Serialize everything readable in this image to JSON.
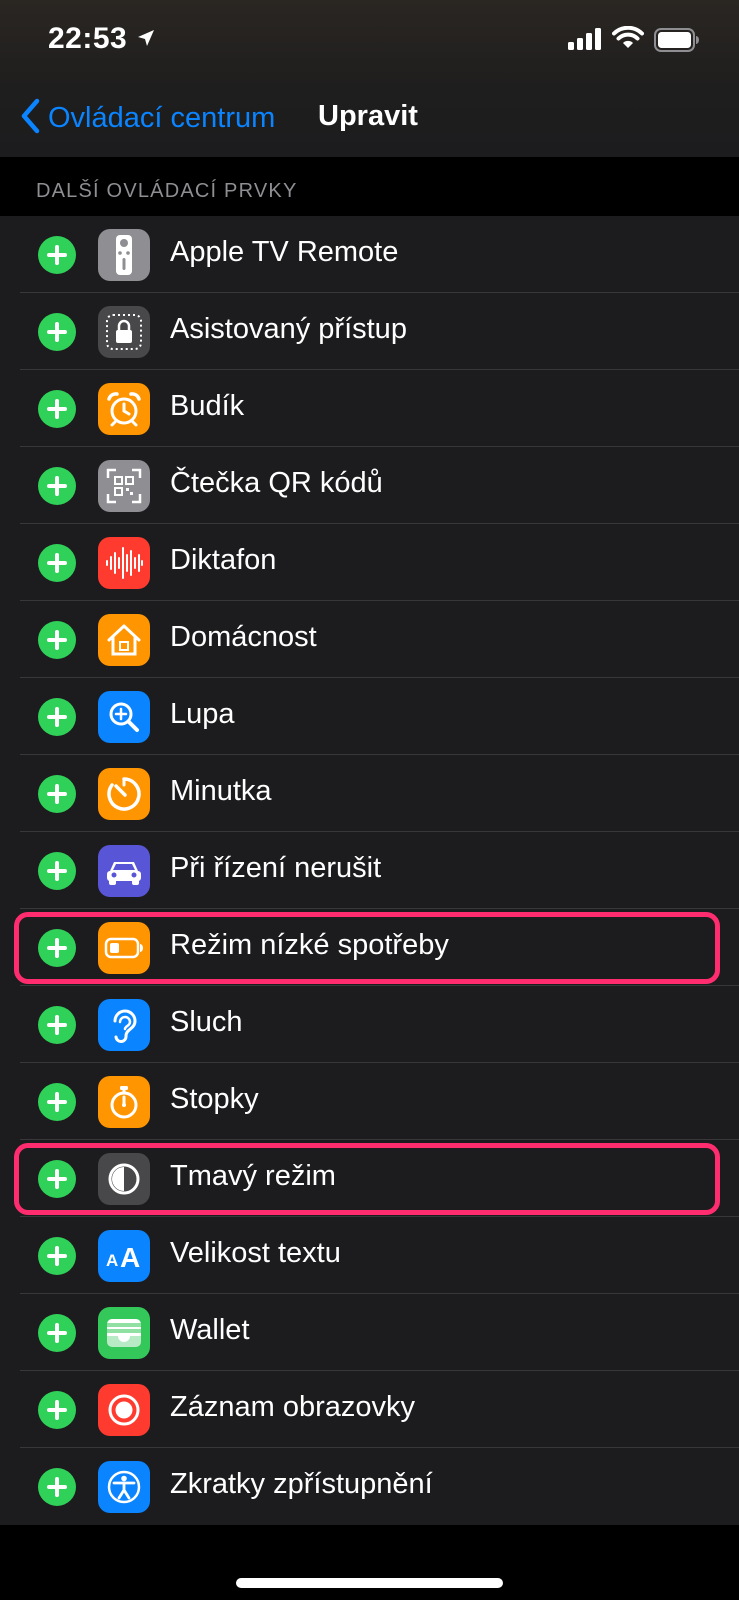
{
  "status_bar": {
    "time": "22:53"
  },
  "nav": {
    "back_label": "Ovládací centrum",
    "title": "Upravit"
  },
  "section": {
    "header": "DALŠÍ OVLÁDACÍ PRVKY"
  },
  "colors": {
    "accent": "#0a84ff",
    "add": "#30d158",
    "highlight": "#ff2d6f",
    "row_bg": "#1c1c1e"
  },
  "controls": [
    {
      "label": "Apple TV Remote",
      "icon": "apple-tv-remote-icon",
      "color": "#8e8e93",
      "highlighted": false
    },
    {
      "label": "Asistovaný přístup",
      "icon": "guided-access-icon",
      "color": "#48484a",
      "highlighted": false
    },
    {
      "label": "Budík",
      "icon": "alarm-clock-icon",
      "color": "#ff9500",
      "highlighted": false
    },
    {
      "label": "Čtečka QR kódů",
      "icon": "qr-code-icon",
      "color": "#8e8e93",
      "highlighted": false
    },
    {
      "label": "Diktafon",
      "icon": "voice-memo-icon",
      "color": "#ff3b30",
      "highlighted": false
    },
    {
      "label": "Domácnost",
      "icon": "home-icon",
      "color": "#ff9500",
      "highlighted": false
    },
    {
      "label": "Lupa",
      "icon": "magnifier-icon",
      "color": "#0a84ff",
      "highlighted": false
    },
    {
      "label": "Minutka",
      "icon": "timer-icon",
      "color": "#ff9500",
      "highlighted": false
    },
    {
      "label": "Při řízení nerušit",
      "icon": "car-icon",
      "color": "#5856d6",
      "highlighted": false
    },
    {
      "label": "Režim nízké spotřeby",
      "icon": "battery-low-icon",
      "color": "#ff9500",
      "highlighted": true
    },
    {
      "label": "Sluch",
      "icon": "ear-icon",
      "color": "#0a84ff",
      "highlighted": false
    },
    {
      "label": "Stopky",
      "icon": "stopwatch-icon",
      "color": "#ff9500",
      "highlighted": false
    },
    {
      "label": "Tmavý režim",
      "icon": "dark-mode-icon",
      "color": "#48484a",
      "highlighted": true
    },
    {
      "label": "Velikost textu",
      "icon": "text-size-icon",
      "color": "#0a84ff",
      "highlighted": false
    },
    {
      "label": "Wallet",
      "icon": "wallet-icon",
      "color": "#34c759",
      "highlighted": false
    },
    {
      "label": "Záznam obrazovky",
      "icon": "screen-record-icon",
      "color": "#ff3b30",
      "highlighted": false
    },
    {
      "label": "Zkratky zpřístupnění",
      "icon": "accessibility-icon",
      "color": "#0a84ff",
      "highlighted": false
    }
  ]
}
